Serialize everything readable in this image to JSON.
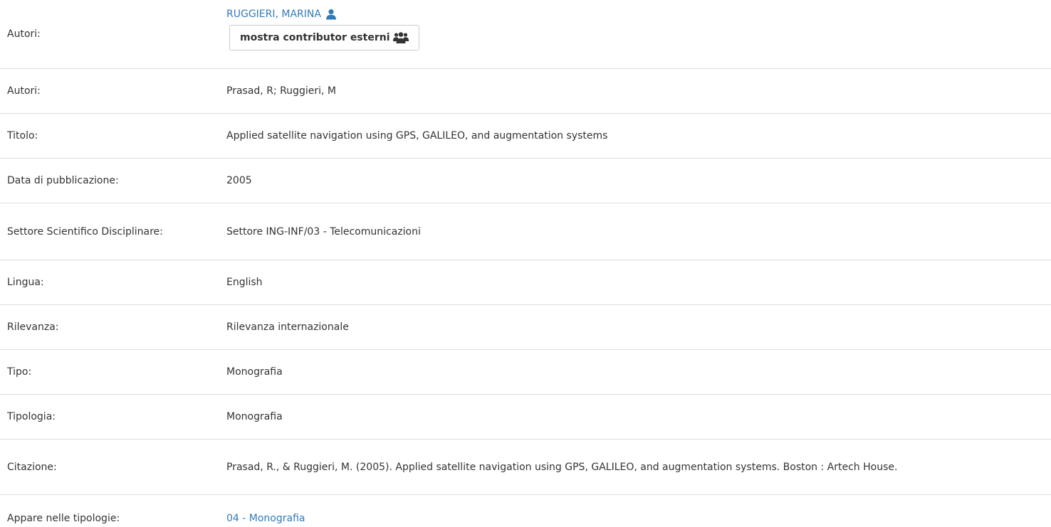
{
  "rows": {
    "autori_primary": {
      "label": "Autori:",
      "author_link": "RUGGIERI, MARINA",
      "author_icon": "user-icon",
      "button_label": "mostra contributor esterni",
      "button_icon": "users-icon"
    },
    "autori": {
      "label": "Autori:",
      "value": "Prasad, R; Ruggieri, M"
    },
    "titolo": {
      "label": "Titolo:",
      "value": "Applied satellite navigation using GPS, GALILEO, and augmentation systems"
    },
    "data": {
      "label": "Data di pubblicazione:",
      "value": "2005"
    },
    "settore": {
      "label": "Settore Scientifico Disciplinare:",
      "value": "Settore ING-INF/03 - Telecomunicazioni"
    },
    "lingua": {
      "label": "Lingua:",
      "value": "English"
    },
    "rilevanza": {
      "label": "Rilevanza:",
      "value": "Rilevanza internazionale"
    },
    "tipo": {
      "label": "Tipo:",
      "value": "Monografia"
    },
    "tipologia": {
      "label": "Tipologia:",
      "value": "Monografia"
    },
    "citazione": {
      "label": "Citazione:",
      "value": "Prasad, R., & Ruggieri, M. (2005). Applied satellite navigation using GPS, GALILEO, and augmentation systems. Boston : Artech House."
    },
    "appare": {
      "label": "Appare nelle tipologie:",
      "link": "04 - Monografia"
    }
  },
  "colors": {
    "link": "#337ab7",
    "text": "#333333",
    "border": "#dddddd"
  }
}
